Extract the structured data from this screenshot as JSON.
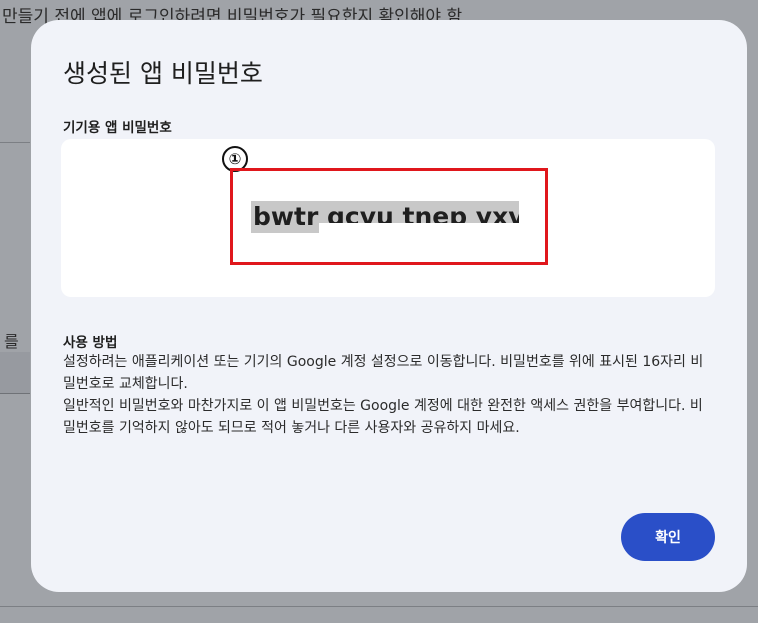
{
  "background": {
    "top_text": "만들기 전에 앱에 로그인하려면 비밀번호가 필요한지 확인해야 함",
    "left_text": "를"
  },
  "dialog": {
    "title": "생성된 앱 비밀번호",
    "password_label": "기기용 앱 비밀번호",
    "password_value": "bwtr qcvu tnep yxvh",
    "annotation_marker": "①",
    "usage_title": "사용 방법",
    "usage_paragraphs": {
      "p1": "설정하려는 애플리케이션 또는 기기의 Google 계정 설정으로 이동합니다. 비밀번호를 위에 표시된 16자리 비밀번호로 교체합니다.",
      "p2": "일반적인 비밀번호와 마찬가지로 이 앱 비밀번호는 Google 계정에 대한 완전한 액세스 권한을 부여합니다. 비밀번호를 기억하지 않아도 되므로 적어 놓거나 다른 사용자와 공유하지 마세요."
    },
    "confirm_button_label": "확인"
  },
  "colors": {
    "dialog_background": "#f1f3f9",
    "button_accent": "#2a4fc8",
    "annotation_red": "#e0171c",
    "overlay": "#a0a3a8"
  }
}
